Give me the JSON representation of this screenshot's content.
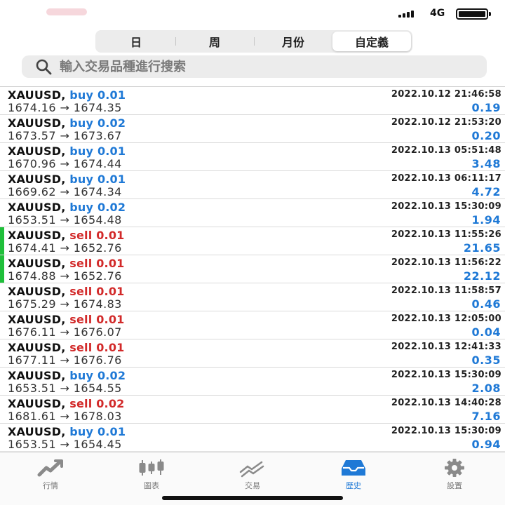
{
  "status_bar": {
    "network": "4G"
  },
  "segments": [
    {
      "label": "日"
    },
    {
      "label": "周"
    },
    {
      "label": "月份"
    },
    {
      "label": "自定義",
      "selected": true
    }
  ],
  "search": {
    "placeholder": "輸入交易品種進行搜索",
    "value": ""
  },
  "trades": [
    {
      "symbol": "XAUUSD,",
      "side": "buy",
      "volume": "0.01",
      "open": "1674.16",
      "close": "1674.35",
      "time": "2022.10.12 21:46:58",
      "profit": "0.19",
      "marked": false
    },
    {
      "symbol": "XAUUSD,",
      "side": "buy",
      "volume": "0.02",
      "open": "1673.57",
      "close": "1673.67",
      "time": "2022.10.12 21:53:20",
      "profit": "0.20",
      "marked": false
    },
    {
      "symbol": "XAUUSD,",
      "side": "buy",
      "volume": "0.01",
      "open": "1670.96",
      "close": "1674.44",
      "time": "2022.10.13 05:51:48",
      "profit": "3.48",
      "marked": false
    },
    {
      "symbol": "XAUUSD,",
      "side": "buy",
      "volume": "0.01",
      "open": "1669.62",
      "close": "1674.34",
      "time": "2022.10.13 06:11:17",
      "profit": "4.72",
      "marked": false
    },
    {
      "symbol": "XAUUSD,",
      "side": "buy",
      "volume": "0.02",
      "open": "1653.51",
      "close": "1654.48",
      "time": "2022.10.13 15:30:09",
      "profit": "1.94",
      "marked": false
    },
    {
      "symbol": "XAUUSD,",
      "side": "sell",
      "volume": "0.01",
      "open": "1674.41",
      "close": "1652.76",
      "time": "2022.10.13 11:55:26",
      "profit": "21.65",
      "marked": true
    },
    {
      "symbol": "XAUUSD,",
      "side": "sell",
      "volume": "0.01",
      "open": "1674.88",
      "close": "1652.76",
      "time": "2022.10.13 11:56:22",
      "profit": "22.12",
      "marked": true
    },
    {
      "symbol": "XAUUSD,",
      "side": "sell",
      "volume": "0.01",
      "open": "1675.29",
      "close": "1674.83",
      "time": "2022.10.13 11:58:57",
      "profit": "0.46",
      "marked": false
    },
    {
      "symbol": "XAUUSD,",
      "side": "sell",
      "volume": "0.01",
      "open": "1676.11",
      "close": "1676.07",
      "time": "2022.10.13 12:05:00",
      "profit": "0.04",
      "marked": false
    },
    {
      "symbol": "XAUUSD,",
      "side": "sell",
      "volume": "0.01",
      "open": "1677.11",
      "close": "1676.76",
      "time": "2022.10.13 12:41:33",
      "profit": "0.35",
      "marked": false
    },
    {
      "symbol": "XAUUSD,",
      "side": "buy",
      "volume": "0.02",
      "open": "1653.51",
      "close": "1654.55",
      "time": "2022.10.13 15:30:09",
      "profit": "2.08",
      "marked": false
    },
    {
      "symbol": "XAUUSD,",
      "side": "sell",
      "volume": "0.02",
      "open": "1681.61",
      "close": "1678.03",
      "time": "2022.10.13 14:40:28",
      "profit": "7.16",
      "marked": false
    },
    {
      "symbol": "XAUUSD,",
      "side": "buy",
      "volume": "0.01",
      "open": "1653.51",
      "close": "1654.45",
      "time": "2022.10.13 15:30:09",
      "profit": "0.94",
      "marked": false
    }
  ],
  "arrow": "→",
  "tab_bar": [
    {
      "label": "行情",
      "icon": "quotes-icon"
    },
    {
      "label": "圖表",
      "icon": "chart-icon"
    },
    {
      "label": "交易",
      "icon": "trade-icon"
    },
    {
      "label": "歷史",
      "icon": "history-icon",
      "active": true
    },
    {
      "label": "設置",
      "icon": "settings-icon"
    }
  ],
  "colors": {
    "buy": "#1f79d6",
    "sell": "#d22a2a",
    "profit": "#1f79d6",
    "marker": "#1fbf3a",
    "active_tab": "#1f79d6",
    "inactive_tab": "#8a8a8a"
  }
}
